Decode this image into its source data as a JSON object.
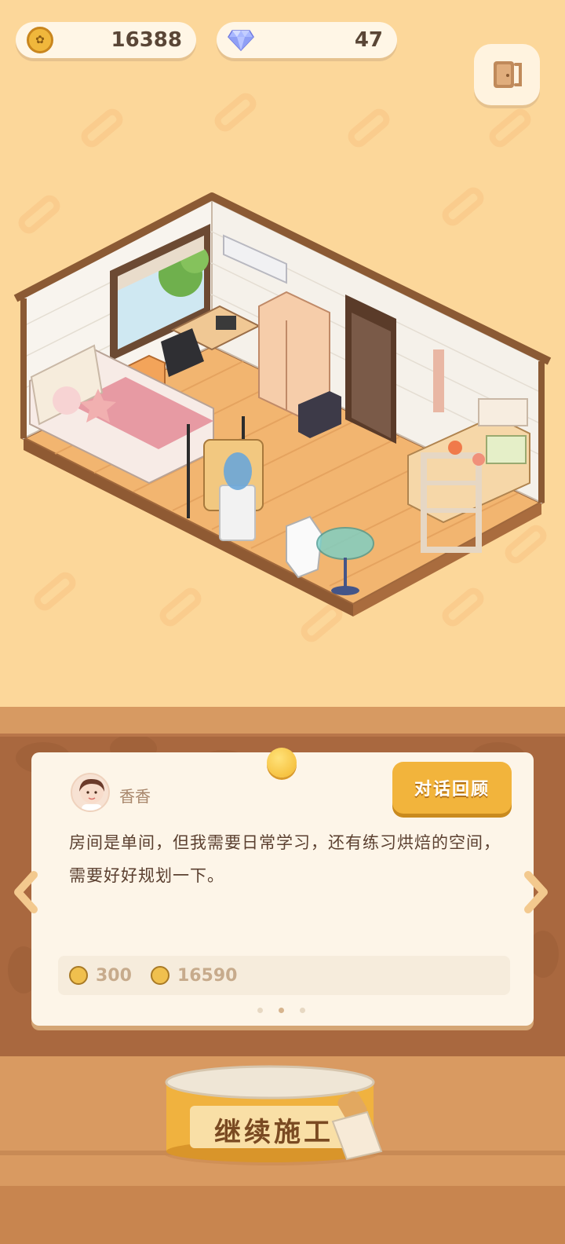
{
  "currency": {
    "coins": "16388",
    "gems": "47"
  },
  "dialogue": {
    "speaker": "香香",
    "text": "房间是单间，但我需要日常学习，还有练习烘焙的空间，需要好好规划一下。",
    "review_button": "对话回顾",
    "rewards": [
      {
        "icon": "medal-icon",
        "value": "300"
      },
      {
        "icon": "coin-icon",
        "value": "16590"
      }
    ],
    "page_dots": 3,
    "active_dot": 1
  },
  "actions": {
    "continue_build": "继续施工"
  },
  "colors": {
    "background": "#fcd79a",
    "panel": "#fdf5e8",
    "accent": "#f2b43c",
    "text": "#5b4030"
  }
}
